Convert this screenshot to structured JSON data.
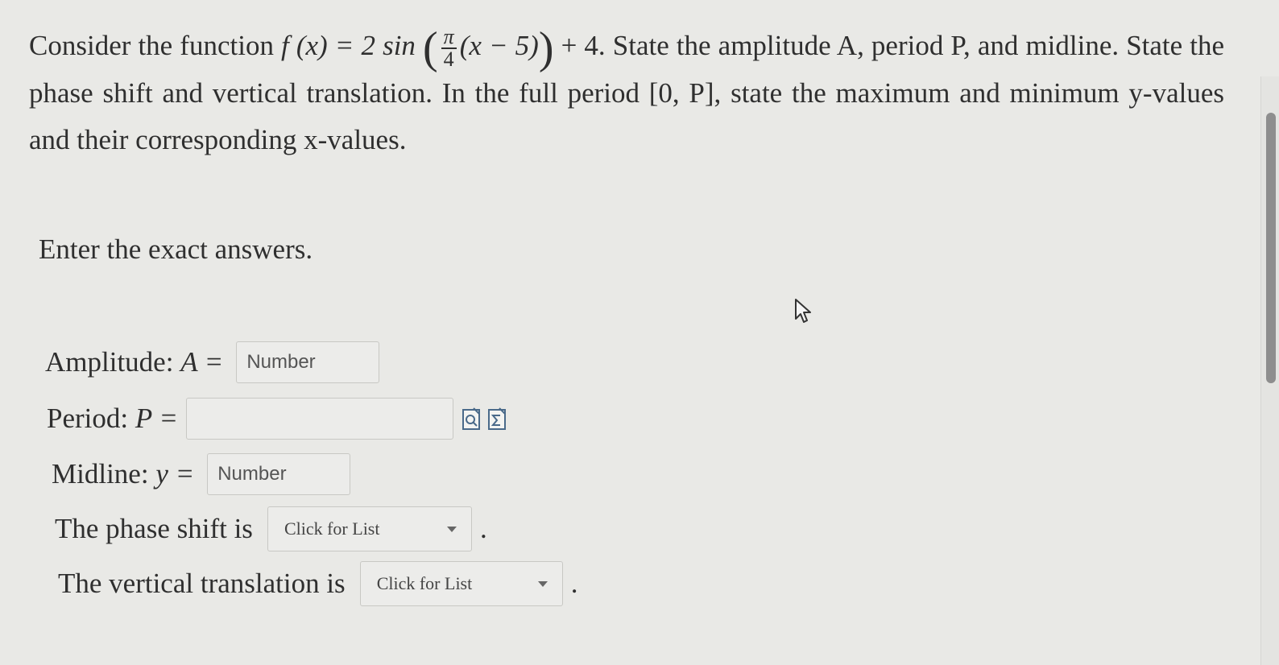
{
  "question": {
    "intro": "Consider the function",
    "func_lhs": "f (x) = 2 sin",
    "frac_num": "π",
    "frac_den": "4",
    "func_inner": "(x − 5)",
    "func_tail": "+ 4.",
    "text_rest": "State the amplitude A, period P, and midline. State the phase shift and vertical translation. In the full period [0, P], state the maximum and minimum y-values and their corresponding x-values."
  },
  "instruction": "Enter the exact answers.",
  "amplitude": {
    "label": "Amplitude:",
    "var": "A =",
    "placeholder": "Number",
    "value": ""
  },
  "period": {
    "label": "Period:",
    "var": "P =",
    "value": "",
    "preview_icon": "preview-icon",
    "equation_icon": "equation-editor-icon"
  },
  "midline": {
    "label": "Midline:",
    "var": "y =",
    "placeholder": "Number",
    "value": ""
  },
  "phase_shift": {
    "label": "The phase shift is",
    "selected": "Click for List",
    "suffix": "."
  },
  "vertical_translation": {
    "label": "The vertical translation is",
    "selected": "Click for List",
    "suffix": "."
  }
}
